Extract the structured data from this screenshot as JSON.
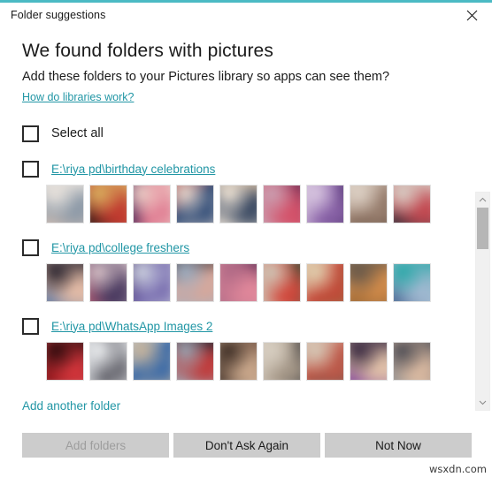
{
  "window": {
    "title": "Folder suggestions",
    "accent_color": "#4bbac4",
    "close_icon": "close-icon"
  },
  "main": {
    "heading": "We found folders with pictures",
    "subheading": "Add these folders to your Pictures library so apps can see them?",
    "help_link": "How do libraries work?",
    "select_all_label": "Select all",
    "add_another_label": "Add another folder",
    "link_color": "#2196a5"
  },
  "folders": [
    {
      "path": "E:\\riya pd\\birthday celebrations",
      "checked": false,
      "thumbnails": [
        {
          "c1": "#cdbcb2",
          "c2": "#8d9aa8",
          "c3": "#e8e2dc"
        },
        {
          "c1": "#2a1b14",
          "c2": "#c03a2f",
          "c3": "#d9b25f"
        },
        {
          "c1": "#3a1b4e",
          "c2": "#e07f94",
          "c3": "#f0d0c8"
        },
        {
          "c1": "#c8453a",
          "c2": "#35507a",
          "c3": "#e8d9cf"
        },
        {
          "c1": "#d9c0a4",
          "c2": "#3b4a63",
          "c3": "#efe4d6"
        },
        {
          "c1": "#6a2a52",
          "c2": "#d4526a",
          "c3": "#c9a2b4"
        },
        {
          "c1": "#452a66",
          "c2": "#8a63a8",
          "c3": "#d8c6e0"
        },
        {
          "c1": "#5b4436",
          "c2": "#9a8070",
          "c3": "#ded2c6"
        },
        {
          "c1": "#2b2f3a",
          "c2": "#c34a52",
          "c3": "#d8cfc6"
        }
      ]
    },
    {
      "path": "E:\\riya pd\\college freshers",
      "checked": false,
      "thumbnails": [
        {
          "c1": "#4e6fa3",
          "c2": "#e3bba6",
          "c3": "#2a2530"
        },
        {
          "c1": "#b05a72",
          "c2": "#4a3a60",
          "c3": "#d9c3c8"
        },
        {
          "c1": "#3c2a66",
          "c2": "#7a6fb0",
          "c3": "#cfd4e2"
        },
        {
          "c1": "#1d1a22",
          "c2": "#d7a79a",
          "c3": "#9fb0c4"
        },
        {
          "c1": "#5c2a52",
          "c2": "#e0879a",
          "c3": "#b06a86"
        },
        {
          "c1": "#2f4a32",
          "c2": "#d24a3e",
          "c3": "#cfc6b6"
        },
        {
          "c1": "#8a6a3a",
          "c2": "#c44a3a",
          "c3": "#e0cfae"
        },
        {
          "c1": "#8a5a2a",
          "c2": "#cf8a4a",
          "c3": "#6a5a4a"
        },
        {
          "c1": "#3a5a8a",
          "c2": "#9fb8d0",
          "c3": "#2aa8a8"
        }
      ]
    },
    {
      "path": "E:\\riya pd\\WhatsApp Images 2",
      "checked": false,
      "thumbnails": [
        {
          "c1": "#7a0d12",
          "c2": "#d0343a",
          "c3": "#2a0a0c"
        },
        {
          "c1": "#cfd2d6",
          "c2": "#6a6a72",
          "c3": "#eceef0"
        },
        {
          "c1": "#d8d2c8",
          "c2": "#3a6aa8",
          "c3": "#c8b49a"
        },
        {
          "c1": "#1e2430",
          "c2": "#c03a3a",
          "c3": "#9aa6b4"
        },
        {
          "c1": "#6a4a3a",
          "c2": "#c8a68a",
          "c3": "#3a2a22"
        },
        {
          "c1": "#2a2a2e",
          "c2": "#a89a8a",
          "c3": "#d8cfc2"
        },
        {
          "c1": "#6a4a42",
          "c2": "#c05a4a",
          "c3": "#d6c8b6"
        },
        {
          "c1": "#7a3a96",
          "c2": "#e0c0a8",
          "c3": "#3a2a42"
        },
        {
          "c1": "#8a8a8c",
          "c2": "#d8b8a0",
          "c3": "#4a4a52"
        }
      ]
    }
  ],
  "footer": {
    "add_folders_label": "Add folders",
    "add_folders_disabled": true,
    "dont_ask_label": "Don't Ask Again",
    "not_now_label": "Not Now"
  },
  "watermark": "wsxdn.com",
  "scrollbar": {
    "up_arrow": "chevron-up-icon",
    "down_arrow": "chevron-down-icon"
  }
}
